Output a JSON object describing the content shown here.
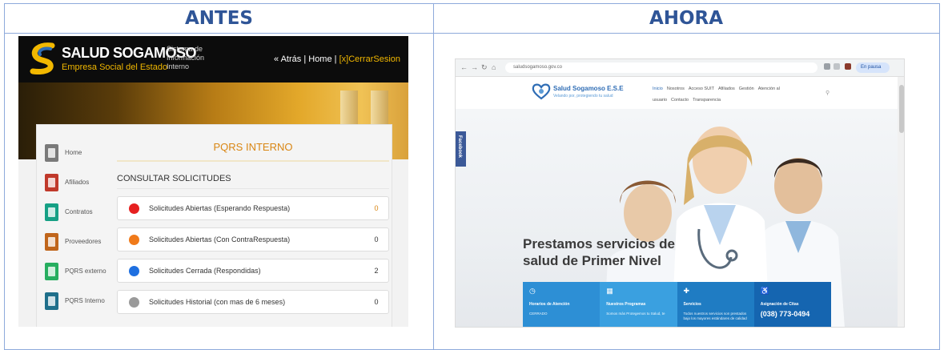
{
  "headers": {
    "antes": "ANTES",
    "ahora": "AHORA"
  },
  "antes": {
    "brand": "SALUD SOGAMOSO",
    "brand_sub": "Empresa Social del Estado",
    "system_name": "Sistema de Información Interno",
    "nav": {
      "back": "« Atrás",
      "home": "Home",
      "logout": "[x]CerrarSesion",
      "separator": "|"
    },
    "sidebar": [
      {
        "label": "Home",
        "color": "#7a7a7a"
      },
      {
        "label": "Afiliados",
        "color": "#c0392b"
      },
      {
        "label": "Contratos",
        "color": "#16a085"
      },
      {
        "label": "Proveedores",
        "color": "#c0651b"
      },
      {
        "label": "PQRS externo",
        "color": "#27ae60"
      },
      {
        "label": "PQRS Interno",
        "color": "#1f6f8b"
      }
    ],
    "panel_title": "PQRS INTERNO",
    "section_title": "CONSULTAR SOLICITUDES",
    "requests": [
      {
        "label": "Solicitudes Abiertas (Esperando Respuesta)",
        "count": "0",
        "color": "#e62020",
        "count_color": "#d98613"
      },
      {
        "label": "Solicitudes Abiertas (Con ContraRespuesta)",
        "count": "0",
        "color": "#f07a1a",
        "count_color": "#333333"
      },
      {
        "label": "Solicitudes Cerrada (Respondidas)",
        "count": "2",
        "color": "#1e6fe0",
        "count_color": "#333333"
      },
      {
        "label": "Solicitudes Historial (con mas de 6 meses)",
        "count": "0",
        "color": "#9a9a9a",
        "count_color": "#333333"
      }
    ]
  },
  "ahora": {
    "browser": {
      "url": "saludsogamoso.gov.co",
      "profile": "En pausa"
    },
    "site": {
      "logo_text": "Salud Sogamoso E.S.E",
      "logo_sub": "Velando por, protegiendo tu salud",
      "menu": [
        "Inicio",
        "Nosotros",
        "Acceso SUIT",
        "Afiliados",
        "Gestión",
        "Atención al usuario",
        "Contacto",
        "Transparencia"
      ],
      "facebook_tab": "Facebook",
      "headline": "Prestamos servicios de salud de Primer Nivel",
      "cards": [
        {
          "icon": "clock-icon",
          "title": "Horarios de Atención",
          "text": "CERRADO",
          "color": "#2d8fd5"
        },
        {
          "icon": "calendar-icon",
          "title": "Nuestros Programas",
          "text": "Somos más Protegemos tu Salud, te",
          "color": "#3aa0e0"
        },
        {
          "icon": "hospital-icon",
          "title": "Servicios",
          "text": "Todos nuestros servicios son prestados bajo los mayores estándares de calidad",
          "color": "#1f7cc3"
        },
        {
          "icon": "wheelchair-icon",
          "title": "Asignación de Citas",
          "text": "(038) 773-0494",
          "color": "#1565b0"
        }
      ]
    }
  }
}
